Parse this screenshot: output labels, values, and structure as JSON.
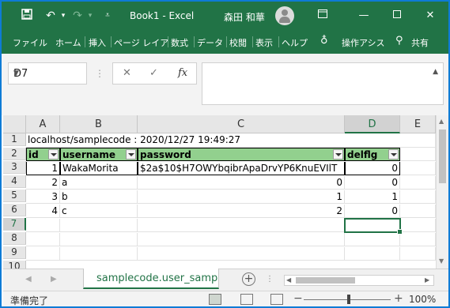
{
  "app": {
    "window_title": "Book1  -  Excel",
    "user_name": "森田 和華",
    "accent_color": "#217346"
  },
  "quick_access": {
    "save_icon": "save-icon",
    "undo_icon": "undo-icon",
    "redo_icon": "redo-icon",
    "customize_icon": "customize-icon"
  },
  "ribbon": {
    "tabs": [
      "ファイル",
      "ホーム",
      "挿入",
      "ページ レイア",
      "数式",
      "データ",
      "校閲",
      "表示",
      "ヘルプ"
    ],
    "tell_me": "操作アシス",
    "share": "共有"
  },
  "formula_bar": {
    "name_box": "D7",
    "cancel_icon": "✕",
    "enter_icon": "✓",
    "fx_label": "fx",
    "formula": ""
  },
  "grid": {
    "columns": [
      "A",
      "B",
      "C",
      "D",
      "E"
    ],
    "selected_column": "D",
    "rows": [
      "1",
      "2",
      "3",
      "4",
      "5",
      "6",
      "7",
      "8",
      "9",
      "10"
    ],
    "selected_row": "7",
    "title_cell": "localhost/samplecode : 2020/12/27 19:49:27",
    "headers": [
      "id",
      "username",
      "password",
      "delflg"
    ],
    "data": [
      {
        "id": "1",
        "username": "WakaMorita",
        "password": "$2a$10$H7OWYbqibrApaDrvYP6KnuEVIlT",
        "delflg": "0"
      },
      {
        "id": "2",
        "username": "a",
        "password": "0",
        "delflg": "0"
      },
      {
        "id": "3",
        "username": "b",
        "password": "1",
        "delflg": "1"
      },
      {
        "id": "4",
        "username": "c",
        "password": "2",
        "delflg": "0"
      }
    ]
  },
  "sheets": {
    "active": "samplecode.user_samp"
  },
  "status": {
    "ready": "準備完了",
    "zoom": "100%"
  }
}
